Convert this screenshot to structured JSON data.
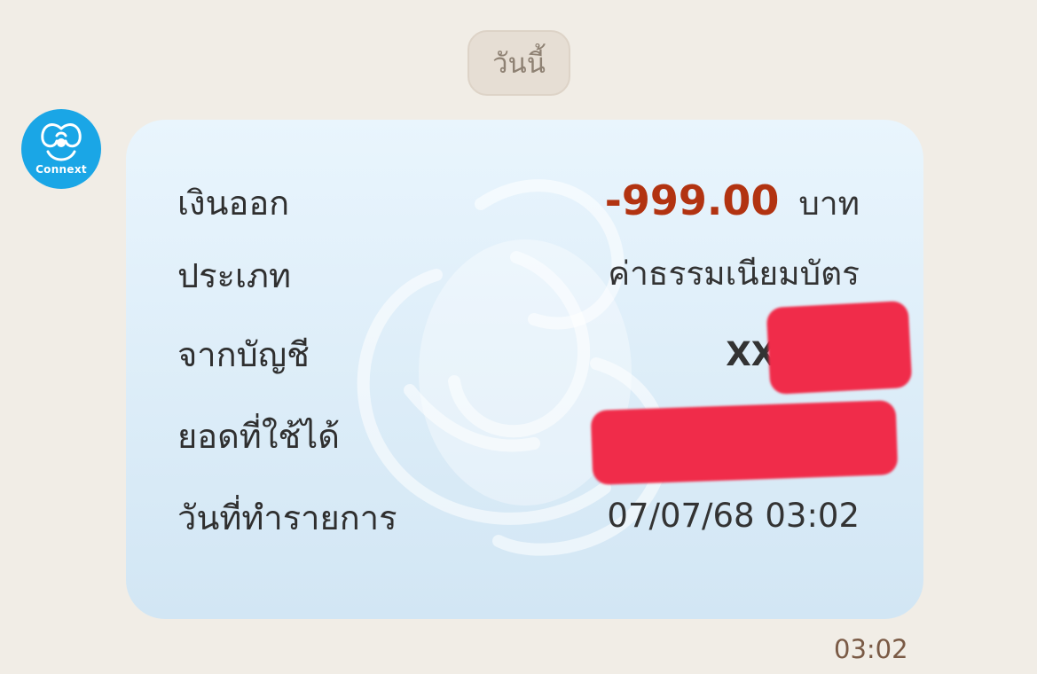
{
  "chat": {
    "date_label": "วันนี้",
    "time": "03:02"
  },
  "sender": {
    "avatar_text": "Connext",
    "avatar_color": "#1aa6e6"
  },
  "card": {
    "rows": [
      {
        "label": "เงินออก",
        "value": "-999.00",
        "unit": "บาท"
      },
      {
        "label": "ประเภท",
        "value": "ค่าธรรมเนียมบัตร"
      },
      {
        "label": "จากบัญชี",
        "value": "XX1"
      },
      {
        "label": "ยอดที่ใช้ได้",
        "value": ""
      },
      {
        "label": "วันที่ทำรายการ",
        "value": "07/07/68 03:02"
      }
    ],
    "amount_color": "#b23311",
    "redaction_color": "#f02c4a"
  }
}
